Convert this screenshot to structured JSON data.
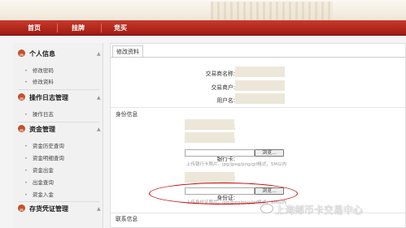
{
  "nav": {
    "home": "首页",
    "listing": "挂牌",
    "bidding": "竞买"
  },
  "sidebar": {
    "personal": {
      "title": "个人信息",
      "items": [
        "修改密码",
        "修改资料"
      ]
    },
    "log": {
      "title": "操作日志管理",
      "items": [
        "操作日志"
      ]
    },
    "funds": {
      "title": "资金管理",
      "items": [
        "资金历史查询",
        "资金明细查询",
        "资金出金",
        "出金查询",
        "资金入金"
      ]
    },
    "stock": {
      "title": "存货凭证管理"
    }
  },
  "main": {
    "tab": "修改资料",
    "fields": {
      "trader_name": "交易商名称:",
      "trader_account": "交易商户:",
      "username": "用户名:",
      "bank": "开户银行:",
      "bank_account": "银行帐号:",
      "bank_card": "银行卡:",
      "id_number": "身份证号码:",
      "id_card": "身份证:"
    },
    "identity_section": "身份信息",
    "contact_section": "联系信息",
    "browse_label": "浏览...",
    "bank_card_hint": "上传银行卡照片，jpg/jpeg/png/gif格式，5M以内",
    "id_card_hint": "上传身份证照片，jpg/jpeg/png/gif格式，5M以内"
  },
  "watermark": "上海邮币卡交易中心",
  "colors": {
    "nav": "#b0251a",
    "accent_icon": "#c4502a",
    "highlight": "#c80000"
  }
}
